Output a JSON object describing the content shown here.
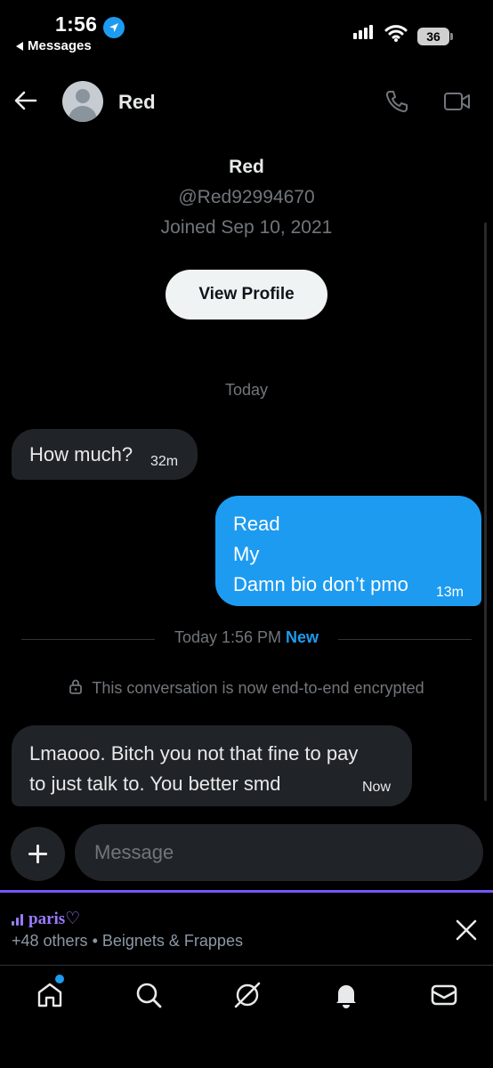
{
  "status_bar": {
    "time": "1:56",
    "back_app_label": "Messages",
    "battery_level": "36"
  },
  "header": {
    "contact_name": "Red",
    "avatar_icon": "default-avatar-icon",
    "phone_icon": "phone-icon",
    "video_icon": "video-camera-icon"
  },
  "profile": {
    "name": "Red",
    "handle": "@Red92994670",
    "joined": "Joined Sep 10, 2021",
    "view_profile_label": "View Profile"
  },
  "conversation": {
    "day_label": "Today",
    "messages": [
      {
        "direction": "incoming",
        "text": "How much?",
        "time": "32m"
      },
      {
        "direction": "outgoing",
        "lines": [
          "Read",
          "My",
          "Damn bio don’t pmo"
        ],
        "time": "13m"
      },
      {
        "direction": "incoming",
        "lines": [
          "Lmaooo. Bitch you not that fine to pay",
          "to just talk to. You better smd"
        ],
        "time": "Now"
      }
    ],
    "divider_time": "Today 1:56 PM",
    "divider_new": "New",
    "encryption_notice": "This conversation is now end-to-end encrypted"
  },
  "composer": {
    "placeholder": "Message"
  },
  "spaces_bar": {
    "title": "paris♡",
    "subtitle": "+48 others • Beignets & Frappes",
    "accent_color": "#7856ff"
  },
  "nav": {
    "items": [
      "home-icon",
      "search-icon",
      "grok-icon",
      "notifications-icon",
      "messages-icon"
    ]
  },
  "colors": {
    "background": "#000000",
    "incoming_bubble": "#202327",
    "outgoing_bubble": "#1d9bf0",
    "muted_text": "#71767b"
  }
}
